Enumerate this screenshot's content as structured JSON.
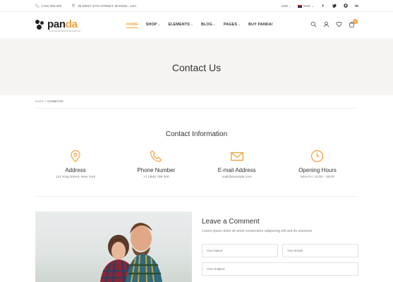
{
  "topbar": {
    "phone": "(+84) 906 000",
    "address": "35 WEST 37TH STREET, MANGEL, USA",
    "currency": "USD",
    "language": "ENG"
  },
  "logo": {
    "part1": "pan",
    "part2": "da"
  },
  "nav": [
    {
      "label": "HOME",
      "active": true,
      "has_menu": false
    },
    {
      "label": "SHOP",
      "has_menu": true
    },
    {
      "label": "ELEMENTS",
      "has_menu": true
    },
    {
      "label": "BLOG",
      "has_menu": true
    },
    {
      "label": "PAGES",
      "has_menu": true
    },
    {
      "label": "BUY PANDA!",
      "has_menu": false
    }
  ],
  "cart": {
    "count": "0"
  },
  "banner": {
    "title": "Contact Us"
  },
  "breadcrumb": {
    "home": "Home",
    "sep": ">",
    "current": "Contact Us"
  },
  "contact_info": {
    "title": "Contact Information",
    "items": [
      {
        "label": "Address",
        "value": "121 King Street, New York",
        "icon": "location-pin-icon"
      },
      {
        "label": "Phone Number",
        "value": "+1 (456) 789 000",
        "icon": "phone-icon"
      },
      {
        "label": "E-mail Address",
        "value": "mail@example.com",
        "icon": "envelope-icon"
      },
      {
        "label": "Opening Hours",
        "value": "Mon-Fri: 10:00 - 18:00",
        "icon": "clock-icon"
      }
    ]
  },
  "comment": {
    "title": "Leave a Comment",
    "subtitle": "Lorem ipsum dolor sit amet consectetur adipiscing elit sed do eiusmod",
    "name_placeholder": "Your Name",
    "email_placeholder": "Your Email",
    "subject_placeholder": "Your Subject"
  },
  "colors": {
    "accent": "#f2a33a",
    "banner_bg": "#f5f4f2"
  }
}
